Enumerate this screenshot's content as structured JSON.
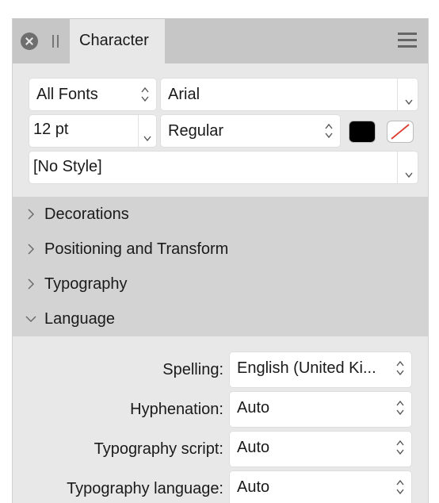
{
  "panel": {
    "tab_label": "Character",
    "icons": {
      "close": "close-icon",
      "grip": "grip-icon",
      "menu": "hamburger-menu-icon"
    }
  },
  "font_row": {
    "collection": "All Fonts",
    "family": "Arial"
  },
  "size_row": {
    "size": "12 pt",
    "style": "Regular",
    "fill_color": "#000000",
    "stroke_color": "none"
  },
  "style_row": {
    "style_name": "[No Style]"
  },
  "sections": [
    {
      "label": "Decorations",
      "expanded": false
    },
    {
      "label": "Positioning and Transform",
      "expanded": false
    },
    {
      "label": "Typography",
      "expanded": false
    },
    {
      "label": "Language",
      "expanded": true
    }
  ],
  "language": {
    "rows": [
      {
        "label": "Spelling:",
        "value": "English (United Ki..."
      },
      {
        "label": "Hyphenation:",
        "value": "Auto"
      },
      {
        "label": "Typography script:",
        "value": "Auto"
      },
      {
        "label": "Typography language:",
        "value": "Auto"
      }
    ]
  }
}
